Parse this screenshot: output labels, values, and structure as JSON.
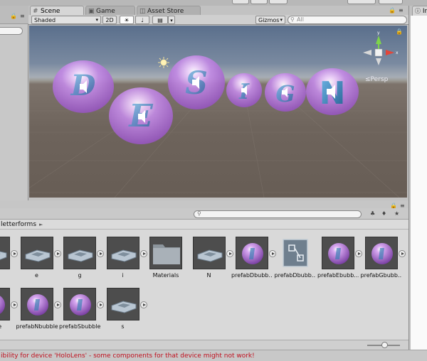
{
  "tabs": {
    "scene": "Scene",
    "game": "Game",
    "asset_store": "Asset Store",
    "inspector": "In"
  },
  "toolbar": {
    "shading_mode": "Shaded",
    "mode_2d": "2D",
    "gizmos": "Gizmos",
    "search_placeholder": "All"
  },
  "scene": {
    "persp_label": "≤Persp",
    "letters": [
      "D",
      "E",
      "S",
      "I",
      "G",
      "N"
    ],
    "colors": {
      "sky": "#5a6f8c",
      "ground": "#6e645c",
      "bubble": "#b477d6",
      "letter": "#3f7fb3",
      "gizmo_y": "#7ed44a",
      "gizmo_x": "#e2463a"
    }
  },
  "project": {
    "breadcrumb": "letterforms",
    "assets_row1": [
      {
        "label": "",
        "kind": "letter",
        "icon": "letter-model-icon"
      },
      {
        "label": "e",
        "kind": "letter",
        "icon": "letter-model-icon"
      },
      {
        "label": "g",
        "kind": "letter",
        "icon": "letter-model-icon"
      },
      {
        "label": "i",
        "kind": "letter",
        "icon": "letter-model-icon"
      },
      {
        "label": "Materials",
        "kind": "folder",
        "icon": "folder-icon"
      },
      {
        "label": "N",
        "kind": "letter",
        "icon": "letter-model-icon"
      },
      {
        "label": "prefabDbubb…",
        "kind": "bubble",
        "icon": "bubble-prefab-icon"
      },
      {
        "label": "prefabDbubb…",
        "kind": "prefab",
        "icon": "prefab-icon"
      },
      {
        "label": "prefabEbubb…",
        "kind": "bubble",
        "icon": "bubble-prefab-icon"
      },
      {
        "label": "prefabGbubb…",
        "kind": "bubble",
        "icon": "bubble-prefab-icon"
      }
    ],
    "assets_row2": [
      {
        "label": "ubble",
        "kind": "bubble",
        "icon": "bubble-prefab-icon"
      },
      {
        "label": "prefabNbubble",
        "kind": "bubble",
        "icon": "bubble-prefab-icon"
      },
      {
        "label": "prefabSbubble",
        "kind": "bubble",
        "icon": "bubble-prefab-icon"
      },
      {
        "label": "s",
        "kind": "letter",
        "icon": "letter-model-icon"
      }
    ]
  },
  "status": {
    "message": "ibility for device 'HoloLens' - some components for that device might not work!"
  }
}
